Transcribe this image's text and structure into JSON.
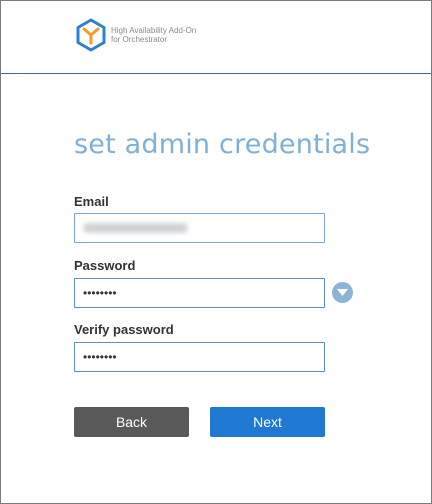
{
  "header": {
    "brand_line1": "High Availability Add-On",
    "brand_line2": "for Orchestrator",
    "logo_icon": "hexagon-y-logo-icon"
  },
  "form": {
    "title": "set admin credentials",
    "email": {
      "label": "Email",
      "value": ""
    },
    "password": {
      "label": "Password",
      "value": "••••••••",
      "toggle_icon": "chevron-down-icon"
    },
    "verify_password": {
      "label": "Verify password",
      "value": "••••••••"
    }
  },
  "buttons": {
    "back_label": "Back",
    "next_label": "Next"
  },
  "colors": {
    "title": "#7fb0d8",
    "header_rule": "#3d6a98",
    "field_border": "#7aa6cf",
    "back_button": "#595959",
    "next_button": "#1f78d1",
    "logo_blue": "#2d7fd0",
    "logo_orange": "#f39c2b"
  }
}
